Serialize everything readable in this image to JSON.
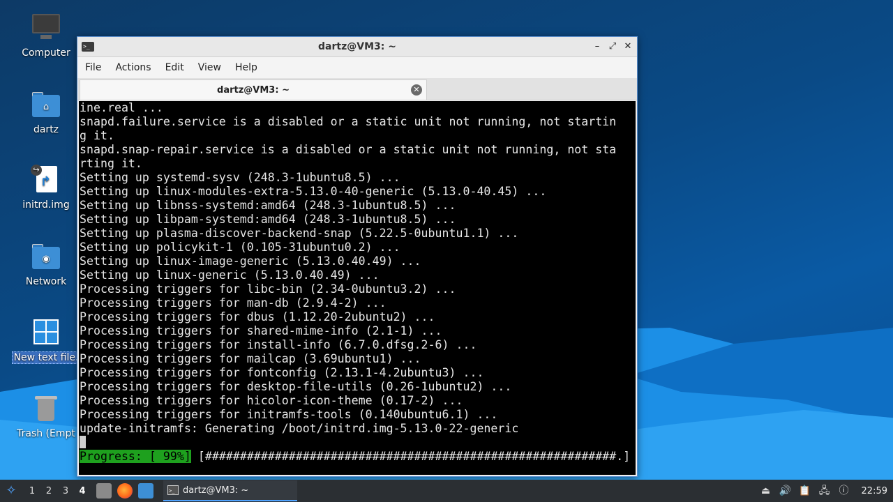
{
  "desktop": {
    "icons": [
      {
        "label": "Computer",
        "icon": "computer-icon"
      },
      {
        "label": "dartz",
        "icon": "home-folder-icon"
      },
      {
        "label": "initrd.img",
        "icon": "symlink-file-icon"
      },
      {
        "label": "Network",
        "icon": "network-folder-icon"
      },
      {
        "label": "New text file.",
        "icon": "windows-logo-icon"
      },
      {
        "label": "Trash (Empt",
        "icon": "trash-icon"
      }
    ]
  },
  "window": {
    "title": "dartz@VM3: ~",
    "controls": {
      "minimize": "–",
      "maximize": "⤢",
      "close": "✕"
    },
    "menu": [
      "File",
      "Actions",
      "Edit",
      "View",
      "Help"
    ],
    "tab": {
      "label": "dartz@VM3: ~",
      "close": "✕"
    }
  },
  "terminal": {
    "lines": [
      "ine.real ...",
      "snapd.failure.service is a disabled or a static unit not running, not startin",
      "g it.",
      "snapd.snap-repair.service is a disabled or a static unit not running, not sta",
      "rting it.",
      "Setting up systemd-sysv (248.3-1ubuntu8.5) ...",
      "Setting up linux-modules-extra-5.13.0-40-generic (5.13.0-40.45) ...",
      "Setting up libnss-systemd:amd64 (248.3-1ubuntu8.5) ...",
      "Setting up libpam-systemd:amd64 (248.3-1ubuntu8.5) ...",
      "Setting up plasma-discover-backend-snap (5.22.5-0ubuntu1.1) ...",
      "Setting up policykit-1 (0.105-31ubuntu0.2) ...",
      "Setting up linux-image-generic (5.13.0.40.49) ...",
      "Setting up linux-generic (5.13.0.40.49) ...",
      "Processing triggers for libc-bin (2.34-0ubuntu3.2) ...",
      "Processing triggers for man-db (2.9.4-2) ...",
      "Processing triggers for dbus (1.12.20-2ubuntu2) ...",
      "Processing triggers for shared-mime-info (2.1-1) ...",
      "Processing triggers for install-info (6.7.0.dfsg.2-6) ...",
      "Processing triggers for mailcap (3.69ubuntu1) ...",
      "Processing triggers for fontconfig (2.13.1-4.2ubuntu3) ...",
      "Processing triggers for desktop-file-utils (0.26-1ubuntu2) ...",
      "Processing triggers for hicolor-icon-theme (0.17-2) ...",
      "Processing triggers for initramfs-tools (0.140ubuntu6.1) ...",
      "update-initramfs: Generating /boot/initrd.img-5.13.0-22-generic"
    ],
    "progress_label": "Progress: [ 99%]",
    "progress_bar": " [###########################################################.]",
    "progress_percent": 99
  },
  "taskbar": {
    "workspaces": [
      "1",
      "2",
      "3",
      "4"
    ],
    "active_workspace": "4",
    "task_label": "dartz@VM3: ~",
    "clock": "22:59"
  },
  "colors": {
    "progress_green": "#1ea01e",
    "taskbar_bg": "#2b2f33",
    "desktop_blue": "#0a4a86"
  }
}
